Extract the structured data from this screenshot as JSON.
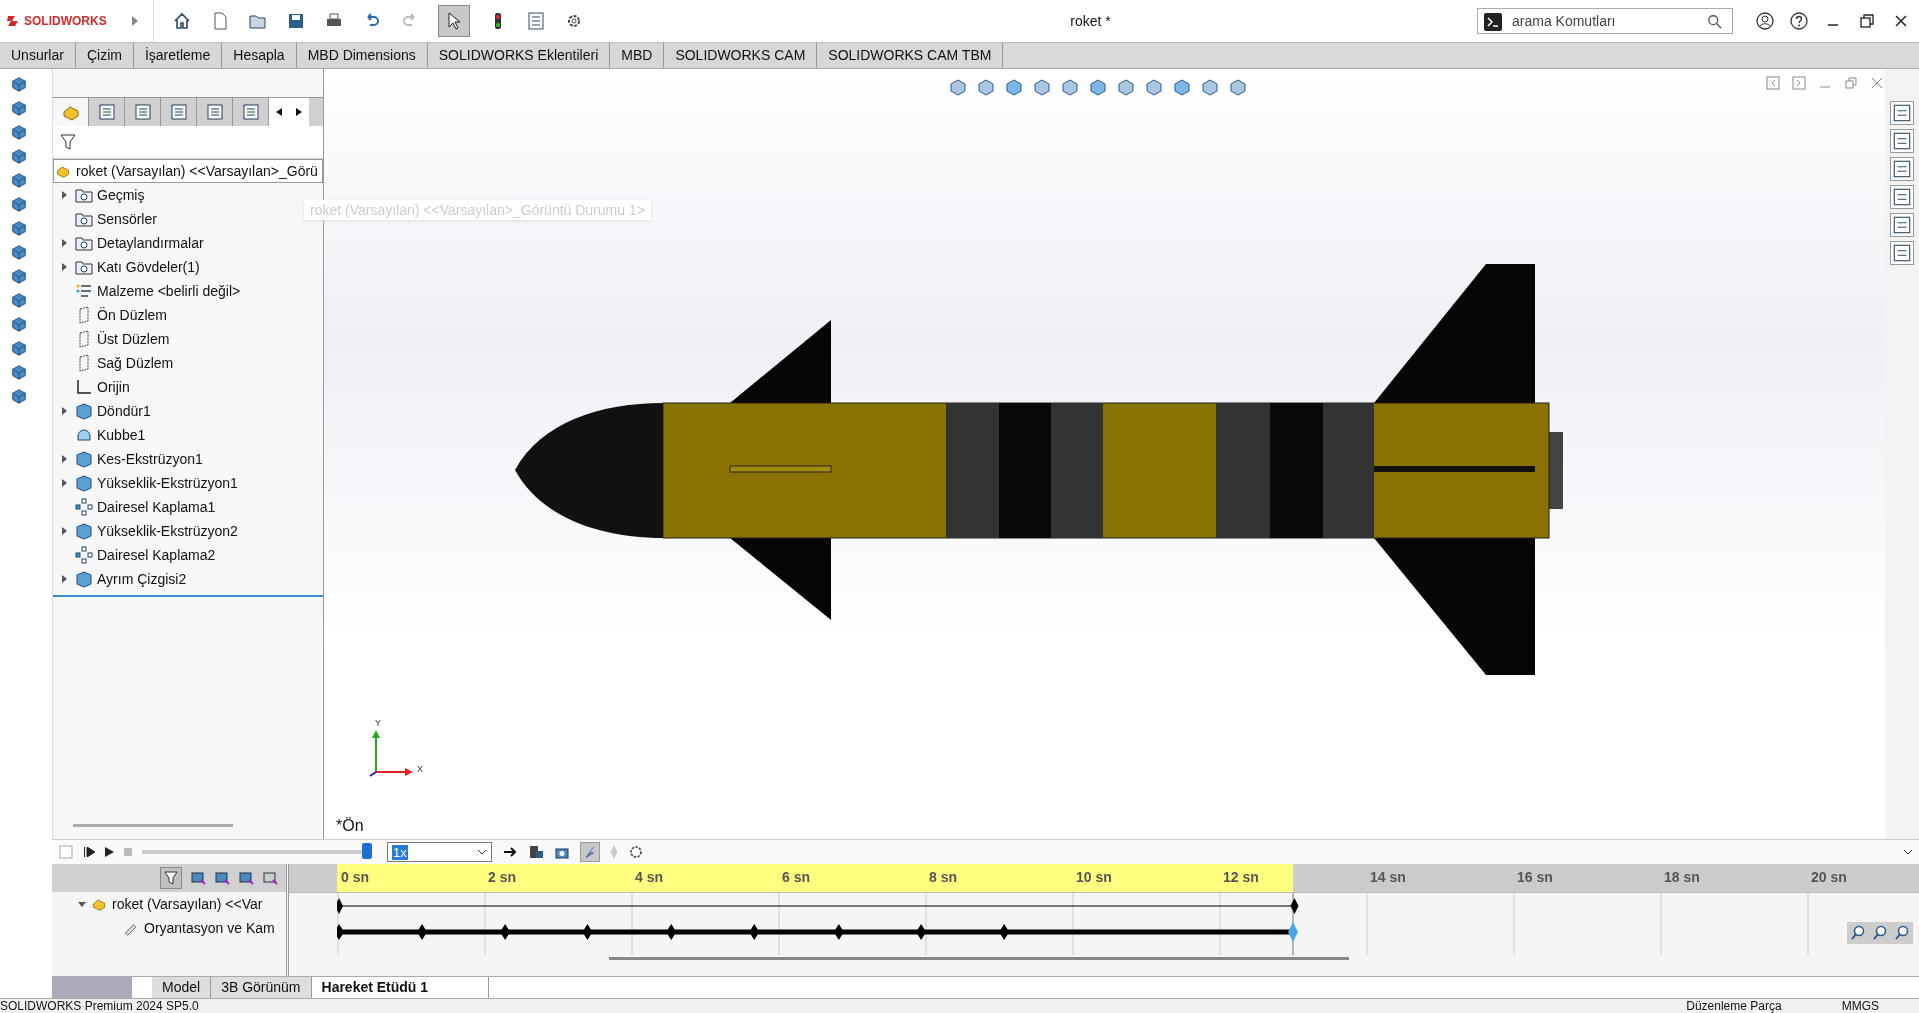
{
  "app": {
    "logo": "SOLIDWORKS",
    "title": "roket *",
    "search": {
      "placeholder": "arama Komutları"
    }
  },
  "command_tabs": [
    {
      "label": "Unsurlar",
      "selected": false
    },
    {
      "label": "Çizim",
      "selected": false
    },
    {
      "label": "İşaretleme",
      "selected": false
    },
    {
      "label": "Hesapla",
      "selected": false
    },
    {
      "label": "MBD Dimensions",
      "selected": false
    },
    {
      "label": "SOLIDWORKS Eklentileri",
      "selected": false
    },
    {
      "label": "MBD",
      "selected": false
    },
    {
      "label": "SOLIDWORKS CAM",
      "selected": false
    },
    {
      "label": "SOLIDWORKS CAM TBM",
      "selected": false
    }
  ],
  "panel_tabs": [
    {
      "selected": true
    },
    {
      "selected": false
    },
    {
      "selected": false
    },
    {
      "selected": false
    },
    {
      "selected": false
    },
    {
      "selected": false
    }
  ],
  "feature_tree": {
    "root": "roket (Varsayılan) <<Varsayılan>_Görü",
    "items": [
      {
        "label": "Geçmiş",
        "expander": true
      },
      {
        "label": "Sensörler",
        "expander": false
      },
      {
        "label": "Detaylandırmalar",
        "expander": true
      },
      {
        "label": "Katı Gövdeler(1)",
        "expander": true
      },
      {
        "label": "Malzeme <belirli değil>",
        "expander": false
      },
      {
        "label": "Ön Düzlem",
        "expander": false
      },
      {
        "label": "Üst Düzlem",
        "expander": false
      },
      {
        "label": "Sağ Düzlem",
        "expander": false
      },
      {
        "label": "Orijin",
        "expander": false
      },
      {
        "label": "Döndür1",
        "expander": true
      },
      {
        "label": "Kubbe1",
        "expander": false
      },
      {
        "label": "Kes-Ekstrüzyon1",
        "expander": true
      },
      {
        "label": "Yükseklik-Ekstrüzyon1",
        "expander": true
      },
      {
        "label": "Dairesel Kaplama1",
        "expander": false
      },
      {
        "label": "Yükseklik-Ekstrüzyon2",
        "expander": true
      },
      {
        "label": "Dairesel Kaplama2",
        "expander": false
      },
      {
        "label": "Ayrım Çizgisi2",
        "expander": true
      }
    ]
  },
  "viewport": {
    "tooltip": "roket (Varsayılan) <<Varsayılan>_Görüntü Durumu 1>",
    "view_label": "*Ön",
    "axis_y": "Y",
    "axis_x": "X"
  },
  "motion_study": {
    "slider": {
      "level": 1.0
    },
    "speed": "1x",
    "rows": [
      {
        "label": "roket (Varsayılan) <<Var",
        "expanded": true
      },
      {
        "label": "Oryantasyon ve Kam"
      }
    ],
    "ticks": [
      "0 sn",
      "2 sn",
      "4 sn",
      "6 sn",
      "8 sn",
      "10 sn",
      "12 sn",
      "14 sn",
      "16 sn",
      "18 sn",
      "20 sn"
    ]
  },
  "bottom_tabs": [
    {
      "label": "Model",
      "selected": false
    },
    {
      "label": "3B Görünüm",
      "selected": false
    },
    {
      "label": "Hareket Etüdü 1",
      "selected": true
    }
  ],
  "status_bar": {
    "product": "SOLIDWORKS Premium 2024 SP5.0",
    "mode": "Düzenleme Parça",
    "units": "MMGS"
  }
}
